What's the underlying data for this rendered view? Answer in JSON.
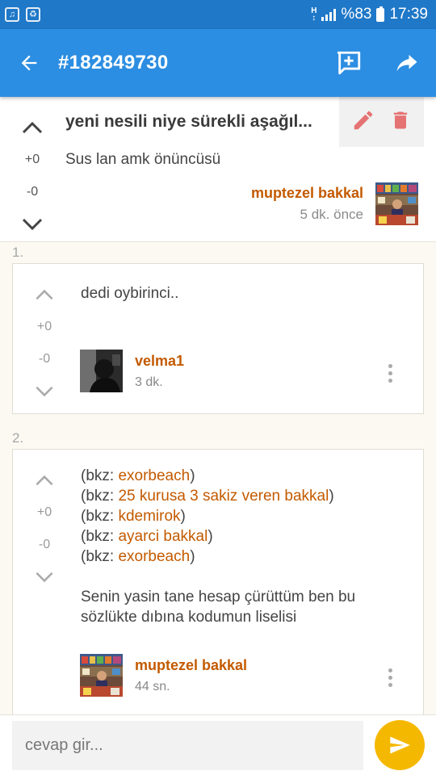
{
  "status_bar": {
    "network": "H",
    "battery": "%83",
    "time": "17:39",
    "icons": [
      "music-notification-icon",
      "recycle-notification-icon"
    ]
  },
  "app_bar": {
    "title": "#182849730",
    "icons": [
      "back-arrow-icon",
      "add-comment-icon",
      "share-icon"
    ]
  },
  "entry": {
    "title": "yeni nesili niye sürekli aşağıl...",
    "text": "Sus lan amk önüncüsü",
    "upvotes": "+0",
    "downvotes": "-0",
    "author": "muptezel bakkal",
    "time": "5 dk. önce",
    "icons": [
      "edit-icon",
      "delete-icon"
    ]
  },
  "comments": [
    {
      "index": "1.",
      "text": "dedi oybirinci..",
      "upvotes": "+0",
      "downvotes": "-0",
      "author": "velma1",
      "time": "3 dk."
    },
    {
      "index": "2.",
      "bkz_prefix": "(bkz: ",
      "bkz_suffix": ")",
      "bkz_links": [
        "exorbeach",
        "25 kurusa 3 sakiz veren bakkal",
        "kdemirok",
        "ayarci bakkal",
        "exorbeach"
      ],
      "text_line1": "Senin yasin tane hesap çürüttüm ben bu",
      "text_line2": "sözlükte dıbına kodumun liselisi",
      "upvotes": "+0",
      "downvotes": "-0",
      "author": "muptezel bakkal",
      "time": "44 sn."
    }
  ],
  "reply": {
    "placeholder": "cevap gir..."
  },
  "colors": {
    "status_bar": "#1f78c8",
    "app_bar": "#2c8ee2",
    "accent_orange": "#c35a00",
    "delete_red": "#e57373",
    "send_yellow": "#f5b800"
  }
}
